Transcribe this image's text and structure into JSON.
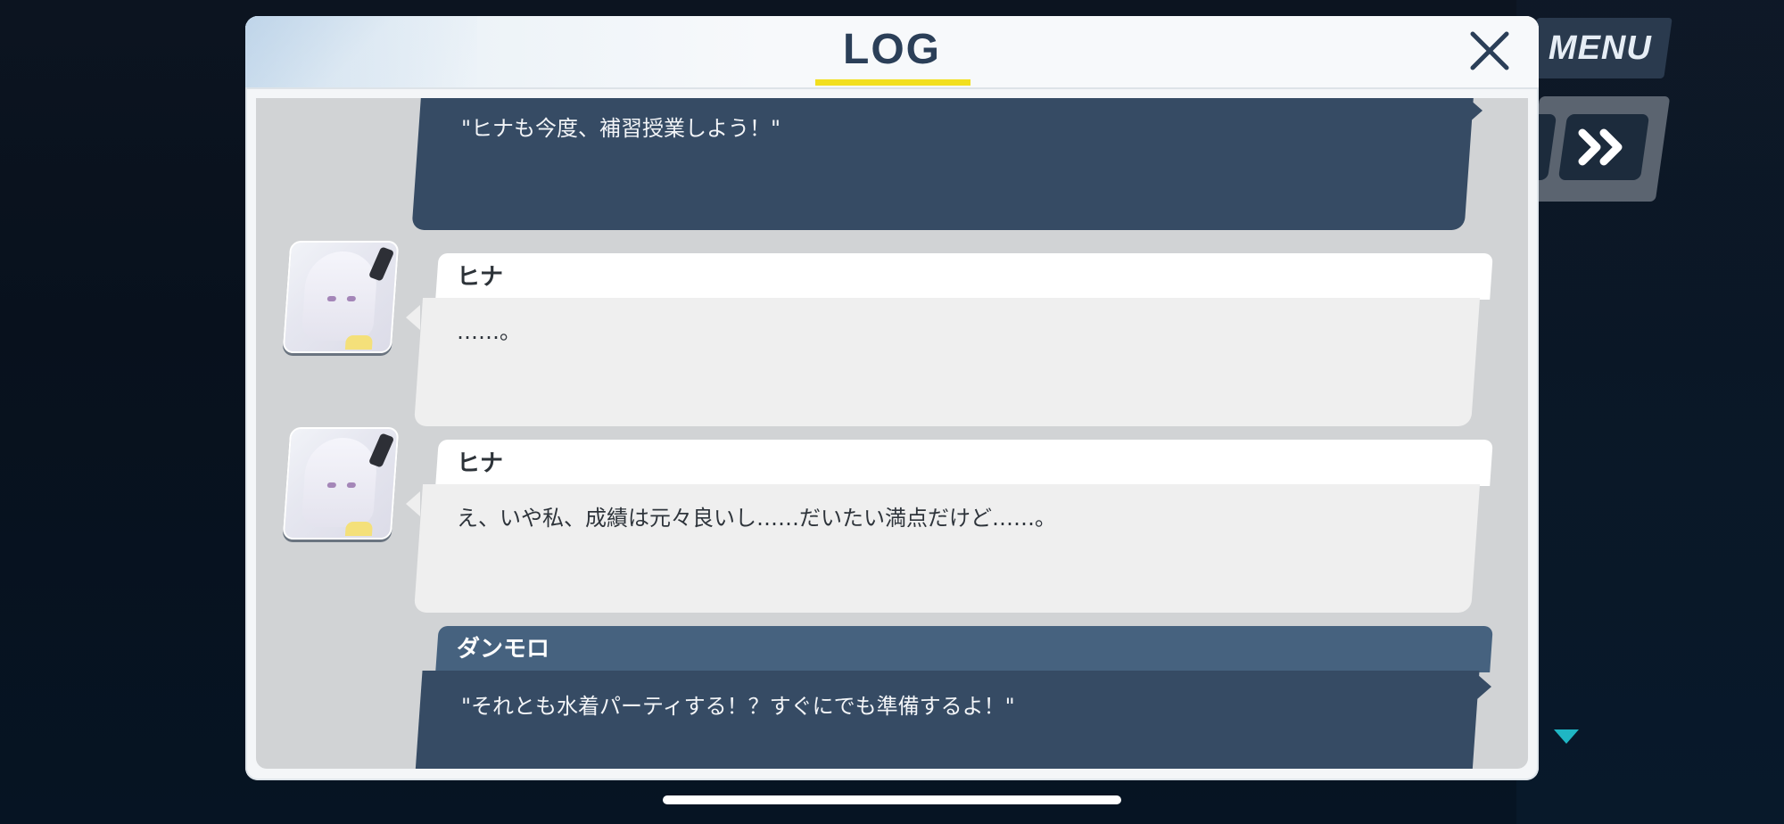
{
  "header": {
    "title": "LOG",
    "close_icon": "close-icon",
    "accent_color": "#f2df1f"
  },
  "side_controls": {
    "menu_label": "MENU",
    "fast_forward_icon": "fast-forward-icon"
  },
  "log_entries": [
    {
      "speaker": "",
      "type": "narration",
      "text": "\"ヒナも今度、補習授業しよう！\""
    },
    {
      "speaker": "ヒナ",
      "type": "character",
      "avatar_icon": "hina-avatar-icon",
      "text": "……。"
    },
    {
      "speaker": "ヒナ",
      "type": "character",
      "avatar_icon": "hina-avatar-icon",
      "text": "え、いや私、成績は元々良いし……だいたい満点だけど……。"
    },
    {
      "speaker": "ダンモロ",
      "type": "player",
      "text": "\"それとも水着パーティする！？すぐにでも準備するよ！\""
    }
  ],
  "colors": {
    "player_box": "#364b64",
    "player_tab": "#46627f",
    "character_box": "#efefef",
    "scroll_indicator": "#1fb6c4"
  }
}
